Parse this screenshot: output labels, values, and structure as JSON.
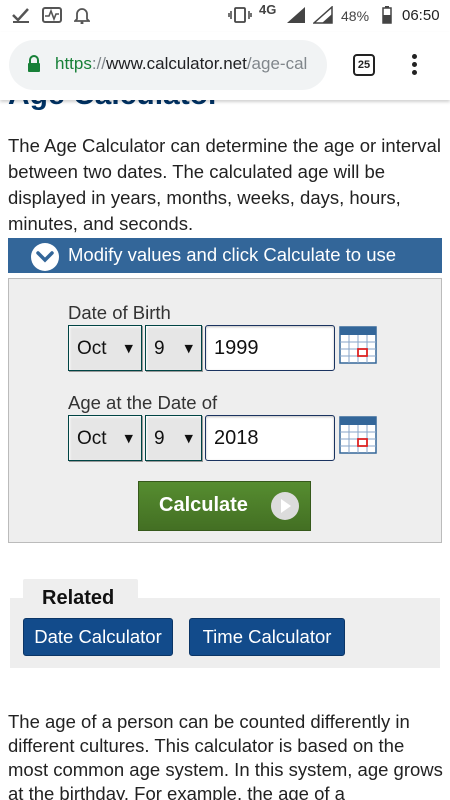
{
  "status_bar": {
    "network": "4G",
    "battery": "48%",
    "time": "06:50"
  },
  "browser": {
    "url_scheme": "https",
    "url_sep": "://",
    "url_host": "www.calculator.net",
    "url_path": "/age-cal",
    "tab_count": "25"
  },
  "page": {
    "title": "Age Calculator",
    "intro": "The Age Calculator can determine the age or interval between two dates. The calculated age will be displayed in years, months, weeks, days, hours, minutes, and seconds.",
    "modify_label": "Modify values and click Calculate to use"
  },
  "form": {
    "birth": {
      "label": "Date of Birth",
      "month": "Oct",
      "day": "9",
      "year": "1999"
    },
    "at_date": {
      "label": "Age at the Date of",
      "month": "Oct",
      "day": "9",
      "year": "2018"
    },
    "calculate_label": "Calculate"
  },
  "related": {
    "title": "Related",
    "links": [
      "Date Calculator",
      "Time Calculator"
    ]
  },
  "body_text": "The age of a person can be counted differently in different cultures. This calculator is based on the most common age system. In this system, age grows at the birthday. For example, the age of a",
  "colors": {
    "title": "#003366",
    "modify_bar": "#336699",
    "calculate": "#4d7f2a",
    "related_button": "#124b8b"
  }
}
